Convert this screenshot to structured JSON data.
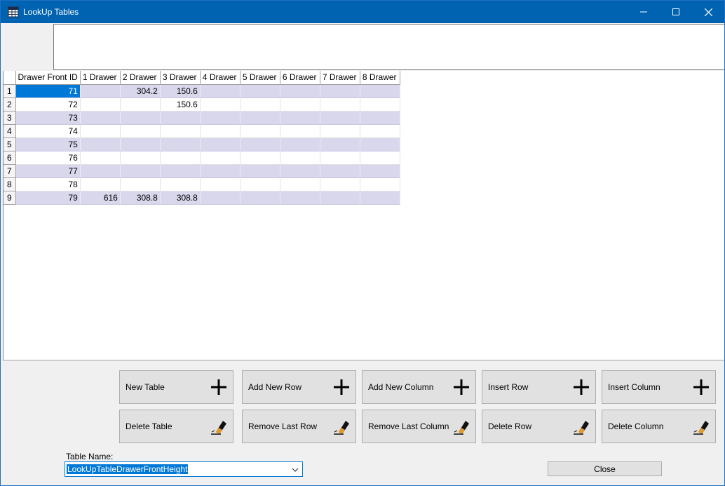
{
  "window": {
    "title": "LookUp Tables"
  },
  "grid": {
    "columns": [
      "Drawer Front ID",
      "1 Drawer",
      "2 Drawer",
      "3 Drawer",
      "4 Drawer",
      "5 Drawer",
      "6 Drawer",
      "7 Drawer",
      "8 Drawer"
    ],
    "rows": [
      {
        "num": "1",
        "cells": [
          "71",
          "",
          "304.2",
          "150.6",
          "",
          "",
          "",
          "",
          ""
        ]
      },
      {
        "num": "2",
        "cells": [
          "72",
          "",
          "",
          "150.6",
          "",
          "",
          "",
          "",
          ""
        ]
      },
      {
        "num": "3",
        "cells": [
          "73",
          "",
          "",
          "",
          "",
          "",
          "",
          "",
          ""
        ]
      },
      {
        "num": "4",
        "cells": [
          "74",
          "",
          "",
          "",
          "",
          "",
          "",
          "",
          ""
        ]
      },
      {
        "num": "5",
        "cells": [
          "75",
          "",
          "",
          "",
          "",
          "",
          "",
          "",
          ""
        ]
      },
      {
        "num": "6",
        "cells": [
          "76",
          "",
          "",
          "",
          "",
          "",
          "",
          "",
          ""
        ]
      },
      {
        "num": "7",
        "cells": [
          "77",
          "",
          "",
          "",
          "",
          "",
          "",
          "",
          ""
        ]
      },
      {
        "num": "8",
        "cells": [
          "78",
          "",
          "",
          "",
          "",
          "",
          "",
          "",
          ""
        ]
      },
      {
        "num": "9",
        "cells": [
          "79",
          "616",
          "308.8",
          "308.8",
          "",
          "",
          "",
          "",
          ""
        ]
      }
    ]
  },
  "buttons": {
    "new_table": "New Table",
    "add_new_row": "Add New Row",
    "add_new_column": "Add New Column",
    "insert_row": "Insert Row",
    "insert_column": "Insert Column",
    "delete_table": "Delete Table",
    "remove_last_row": "Remove Last Row",
    "remove_last_column": "Remove Last Column",
    "delete_row": "Delete Row",
    "delete_column": "Delete Column",
    "close": "Close"
  },
  "table_name": {
    "label": "Table Name:",
    "selected": "LookUpTableDrawerFrontHeight"
  },
  "icons": {
    "add": "plus-icon",
    "delete": "eraser-icon",
    "app": "table-icon"
  },
  "colors": {
    "titlebar": "#0063b1",
    "alt_row": "#d8d7ec",
    "selection": "#0078d7"
  }
}
